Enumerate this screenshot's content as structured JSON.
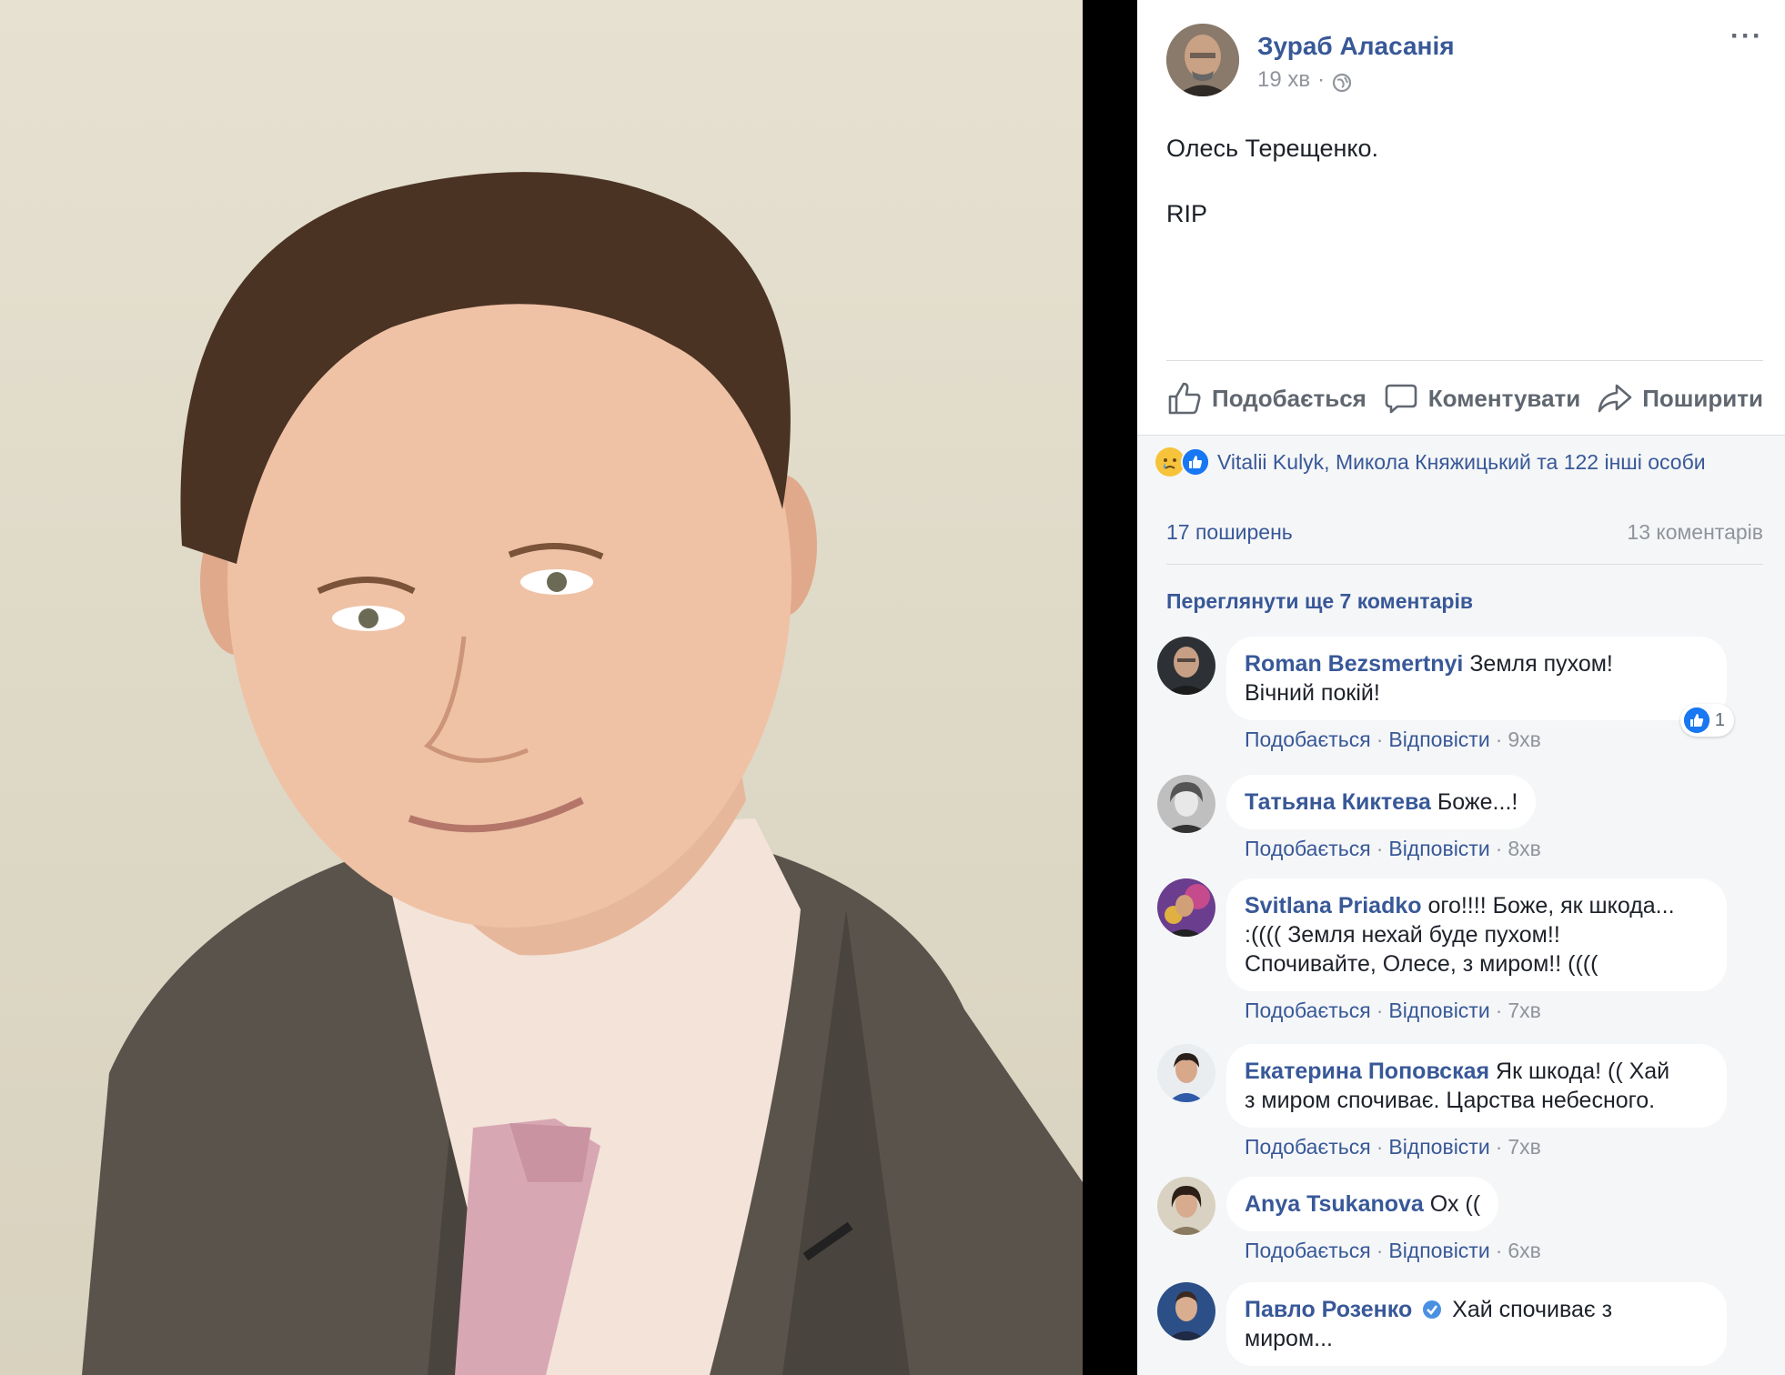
{
  "post": {
    "author": "Зураб Аласанія",
    "time": "19 хв",
    "separator": "·",
    "more": "···",
    "text_lines": [
      "Олесь Терещенко.",
      "RIP"
    ],
    "actions": {
      "like": "Подобається",
      "comment": "Коментувати",
      "share": "Поширити"
    }
  },
  "reactions": {
    "summary": "Vitalii Kulyk, Микола Княжицький та 122 інші особи"
  },
  "stats": {
    "shares": "17 поширень",
    "comments": "13 коментарів"
  },
  "more_comments": "Переглянути ще 7 коментарів",
  "comment_actions": {
    "like": "Подобається",
    "reply": "Відповісти",
    "dot": "·"
  },
  "comments": [
    {
      "name": "Roman Bezsmertnyi",
      "text_lines": [
        "Земля пухом!",
        "Вічний покій!"
      ],
      "time": "9хв",
      "likes": "1"
    },
    {
      "name": "Татьяна Киктева",
      "text_lines": [
        "Боже...!"
      ],
      "time": "8хв"
    },
    {
      "name": "Svitlana Priadko",
      "text_lines": [
        "ого!!!! Боже, як шкода...",
        ":(((( Земля нехай буде пухом!!",
        "Спочивайте, Олесе, з миром!! (((("
      ],
      "time": "7хв"
    },
    {
      "name": "Екатерина Поповская",
      "text_lines": [
        "Як шкода! (( Хай",
        "з миром спочиває. Царства небесного."
      ],
      "time": "7хв"
    },
    {
      "name": "Anya Tsukanova",
      "text_lines": [
        "Ох (("
      ],
      "time": "6хв"
    },
    {
      "name": "Павло Розенко",
      "text_lines": [
        "Хай спочиває з",
        "миром..."
      ]
    }
  ],
  "colors": {
    "link": "#385898",
    "muted": "#90949c",
    "like_blue": "#1877f2",
    "panel_bg": "#f5f6f7"
  }
}
